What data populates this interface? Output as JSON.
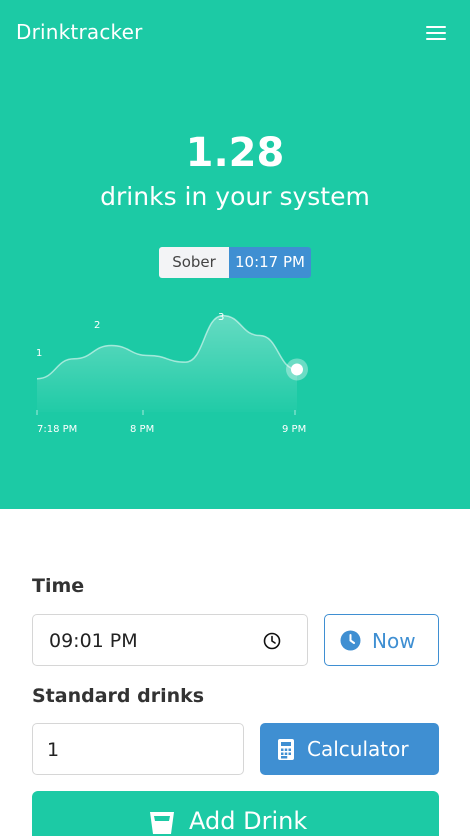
{
  "header": {
    "brand": "Drinktracker",
    "menu_icon": "hamburger-menu-icon"
  },
  "summary": {
    "value": "1.28",
    "caption": "drinks in your system"
  },
  "toggle": {
    "sober_label": "Sober",
    "time_label": "10:17 PM"
  },
  "chart_data": {
    "type": "area",
    "x_ticks": [
      "7:18 PM",
      "8 PM",
      "9 PM"
    ],
    "annotations": [
      "1",
      "2",
      "3"
    ],
    "x": [
      "7:18 PM",
      "7:33 PM",
      "7:48 PM",
      "8:03 PM",
      "8:18 PM",
      "8:33 PM",
      "8:48 PM",
      "9:03 PM"
    ],
    "values": [
      1.0,
      1.6,
      2.0,
      1.7,
      1.5,
      2.9,
      2.3,
      1.28
    ],
    "ylim": [
      0,
      3.2
    ],
    "color": "#ffffff",
    "grid": false,
    "legend": "none"
  },
  "form": {
    "time_label": "Time",
    "time_value": "09:01 PM",
    "time_icon": "clock-icon",
    "now_label": "Now",
    "now_icon": "clock-filled-icon",
    "drinks_label": "Standard drinks",
    "drinks_value": "1",
    "calculator_label": "Calculator",
    "calculator_icon": "calculator-icon",
    "add_label": "Add Drink",
    "add_icon": "glass-icon"
  },
  "colors": {
    "accent": "#1ccaa5",
    "primary": "#3f8fd2"
  }
}
